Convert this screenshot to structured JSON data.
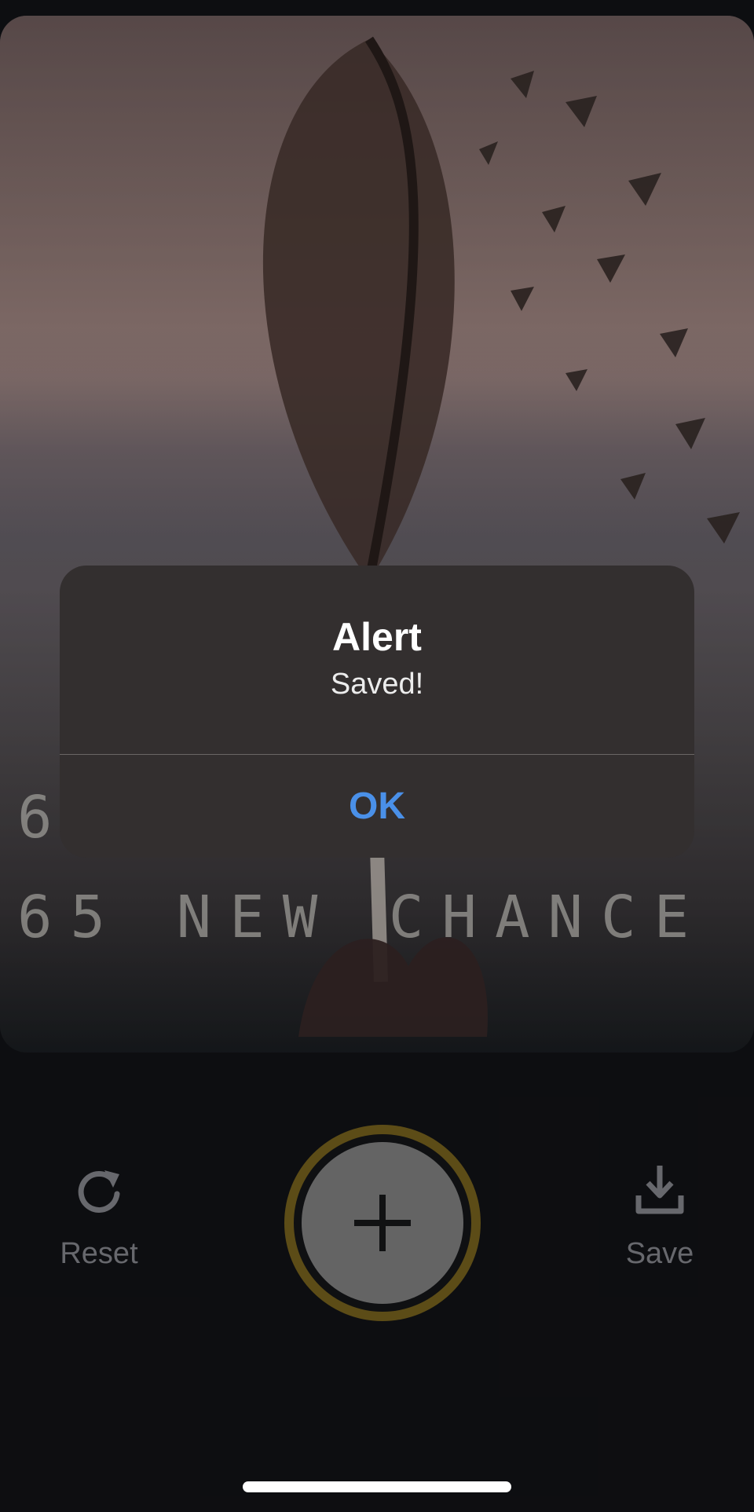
{
  "photo": {
    "line_1": "6",
    "line_2": "65 NEW CHANCE"
  },
  "toolbar": {
    "reset_label": "Reset",
    "save_label": "Save",
    "add_icon": "plus-icon",
    "reset_icon": "refresh-icon",
    "save_icon": "download-icon"
  },
  "alert": {
    "title": "Alert",
    "message": "Saved!",
    "ok_label": "OK",
    "accent": "#4A90E8"
  },
  "colors": {
    "background": "#131418",
    "ring": "#806A20",
    "button_fill": "#8B8B8B"
  }
}
